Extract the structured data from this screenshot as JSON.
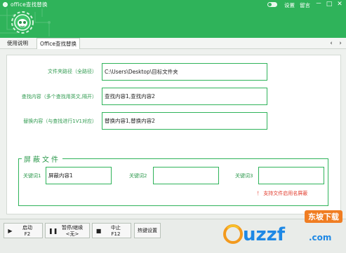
{
  "window": {
    "title": "office查找替换",
    "links": [
      "设置",
      "留言"
    ],
    "controls": {
      "minimize": "－",
      "maximize": "□",
      "close": "✕"
    },
    "accent_color": "#2fb35a"
  },
  "tabs": [
    {
      "label": "使用说明",
      "active": false
    },
    {
      "label": "Office查找替换",
      "active": true
    }
  ],
  "nav": {
    "prev": "‹",
    "next": "›"
  },
  "form": {
    "folder_label": "文件夹路径（全路径）",
    "folder_value": "C:\\Users\\Desktop\\目标文件夹",
    "find_label": "查找内容（多个查找用英文,隔开）",
    "find_value": "查找内容1,查找内容2",
    "replace_label": "替换内容（与查找进行1V1对应）",
    "replace_value": "替换内容1,替换内容2"
  },
  "mask": {
    "title": "屏蔽文件",
    "kw1_label": "关键词1",
    "kw1_value": "屏蔽内容1",
    "kw2_label": "关键词2",
    "kw2_value": "",
    "kw3_label": "关键词3",
    "kw3_value": "",
    "warning": "！ 支持文件启用名屏蔽"
  },
  "toolbar": {
    "start_line1": "启动",
    "start_line2": "F2",
    "pause_line1": "暂停/继续",
    "pause_line2": "<无>",
    "stop_line1": "中止",
    "stop_line2": "F12",
    "hotkey_label": "热键设置",
    "start_icon": "play-icon",
    "pause_icon": "pause-icon",
    "stop_icon": "stop-icon"
  },
  "watermark": {
    "brand": "uzzf",
    "domain": ".com",
    "badge": "东坡下载"
  }
}
